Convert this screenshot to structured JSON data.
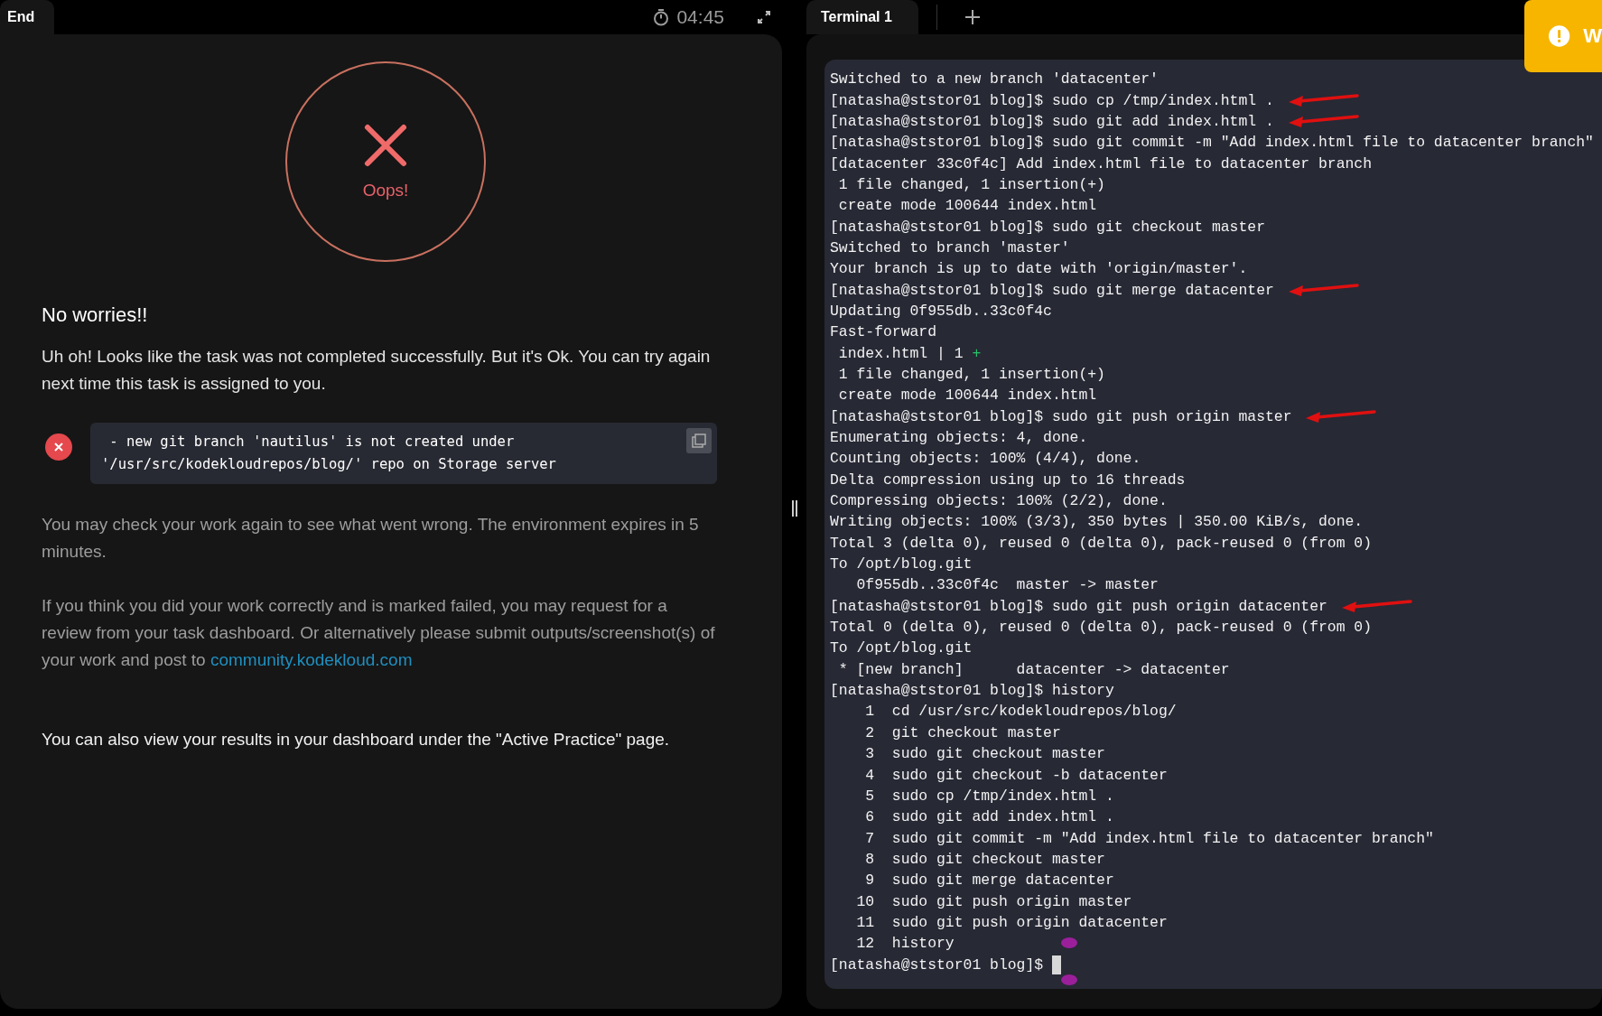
{
  "left_tab": {
    "label": "End",
    "selected": true
  },
  "timer": {
    "time": "04:45"
  },
  "result": {
    "status_label": "Oops!",
    "heading": "No worries!!",
    "message": "Uh oh! Looks like the task was not completed successfully. But it's Ok. You can try again next time this task is assigned to you."
  },
  "errors": [
    {
      "text": " - new git branch 'nautilus' is not created under\n'/usr/src/kodekloudrepos/blog/' repo on Storage server"
    }
  ],
  "info": {
    "check_text": "You may check your work again to see what went wrong. The environment expires in 5 minutes.",
    "review_text": "If you think you did your work correctly and is marked failed, you may request for a review from your task dashboard. Or alternatively please submit outputs/screenshot(s) of your work and post to",
    "review_link": "community.kodekloud.com",
    "dashboard_text": "You can also view your results in your dashboard under the \"Active Practice\" page."
  },
  "terminal_tabs": [
    {
      "label": "Terminal 1",
      "selected": true
    }
  ],
  "toast": {
    "text": "W"
  },
  "terminal": {
    "lines": [
      {
        "text": "Switched to a new branch 'datacenter'",
        "arrow": false
      },
      {
        "text": "[natasha@ststor01 blog]$ sudo cp /tmp/index.html .",
        "arrow": true
      },
      {
        "text": "[natasha@ststor01 blog]$ sudo git add index.html .",
        "arrow": true
      },
      {
        "text": "[natasha@ststor01 blog]$ sudo git commit -m \"Add index.html file to datacenter branch\"",
        "arrow": false
      },
      {
        "text": "[datacenter 33c0f4c] Add index.html file to datacenter branch",
        "arrow": false
      },
      {
        "text": " 1 file changed, 1 insertion(+)",
        "arrow": false
      },
      {
        "text": " create mode 100644 index.html",
        "arrow": false
      },
      {
        "text": "[natasha@ststor01 blog]$ sudo git checkout master",
        "arrow": false
      },
      {
        "text": "Switched to branch 'master'",
        "arrow": false
      },
      {
        "text": "Your branch is up to date with 'origin/master'.",
        "arrow": false
      },
      {
        "text": "[natasha@ststor01 blog]$ sudo git merge datacenter",
        "arrow": true
      },
      {
        "text": "Updating 0f955db..33c0f4c",
        "arrow": false
      },
      {
        "text": "Fast-forward",
        "arrow": false
      },
      {
        "text": " index.html | 1 ",
        "added": "+",
        "arrow": false
      },
      {
        "text": " 1 file changed, 1 insertion(+)",
        "arrow": false
      },
      {
        "text": " create mode 100644 index.html",
        "arrow": false
      },
      {
        "text": "[natasha@ststor01 blog]$ sudo git push origin master",
        "arrow": true
      },
      {
        "text": "Enumerating objects: 4, done.",
        "arrow": false
      },
      {
        "text": "Counting objects: 100% (4/4), done.",
        "arrow": false
      },
      {
        "text": "Delta compression using up to 16 threads",
        "arrow": false
      },
      {
        "text": "Compressing objects: 100% (2/2), done.",
        "arrow": false
      },
      {
        "text": "Writing objects: 100% (3/3), 350 bytes | 350.00 KiB/s, done.",
        "arrow": false
      },
      {
        "text": "Total 3 (delta 0), reused 0 (delta 0), pack-reused 0 (from 0)",
        "arrow": false
      },
      {
        "text": "To /opt/blog.git",
        "arrow": false
      },
      {
        "text": "   0f955db..33c0f4c  master -> master",
        "arrow": false
      },
      {
        "text": "[natasha@ststor01 blog]$ sudo git push origin datacenter",
        "arrow": true
      },
      {
        "text": "Total 0 (delta 0), reused 0 (delta 0), pack-reused 0 (from 0)",
        "arrow": false
      },
      {
        "text": "To /opt/blog.git",
        "arrow": false
      },
      {
        "text": " * [new branch]      datacenter -> datacenter",
        "arrow": false
      },
      {
        "text": "[natasha@ststor01 blog]$ history",
        "arrow": false
      },
      {
        "text": "    1  cd /usr/src/kodekloudrepos/blog/",
        "arrow": false
      },
      {
        "text": "    2  git checkout master",
        "arrow": false
      },
      {
        "text": "    3  sudo git checkout master",
        "arrow": false
      },
      {
        "text": "    4  sudo git checkout -b datacenter",
        "arrow": false
      },
      {
        "text": "    5  sudo cp /tmp/index.html .",
        "arrow": false
      },
      {
        "text": "    6  sudo git add index.html .",
        "arrow": false
      },
      {
        "text": "    7  sudo git commit -m \"Add index.html file to datacenter branch\"",
        "arrow": false
      },
      {
        "text": "    8  sudo git checkout master",
        "arrow": false
      },
      {
        "text": "    9  sudo git merge datacenter",
        "arrow": false
      },
      {
        "text": "   10  sudo git push origin master",
        "arrow": false
      },
      {
        "text": "   11  sudo git push origin datacenter",
        "arrow": false
      },
      {
        "text": "   12  history",
        "arrow": false
      }
    ],
    "prompt": "[natasha@ststor01 blog]$ "
  }
}
